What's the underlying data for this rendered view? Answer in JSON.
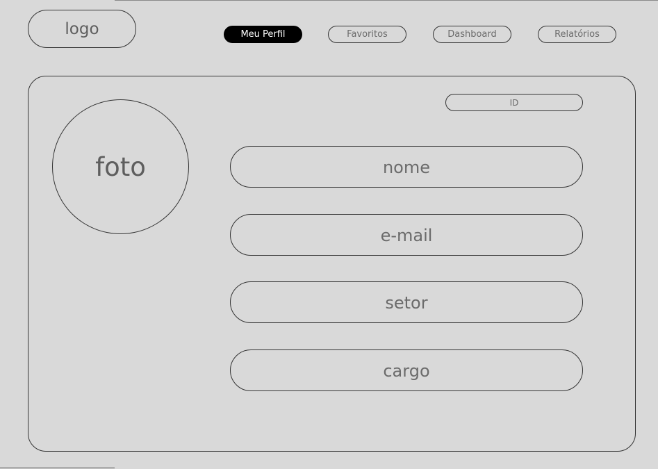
{
  "header": {
    "logo": "logo",
    "nav": [
      {
        "label": "Meu Perfil",
        "active": true
      },
      {
        "label": "Favoritos",
        "active": false
      },
      {
        "label": "Dashboard",
        "active": false
      },
      {
        "label": "Relatórios",
        "active": false
      }
    ]
  },
  "profile": {
    "photo_label": "foto",
    "id_label": "ID",
    "fields": {
      "name": "nome",
      "email": "e-mail",
      "sector": "setor",
      "role": "cargo"
    }
  },
  "colors": {
    "background": "#d9d9d9",
    "border": "#333333",
    "text": "#6b6b6b",
    "active_nav_bg": "#000000",
    "active_nav_text": "#ffffff"
  }
}
